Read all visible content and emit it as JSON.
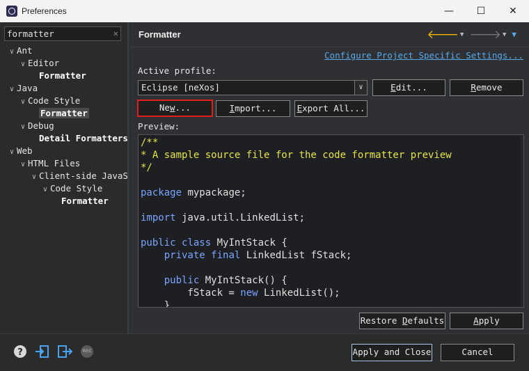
{
  "window": {
    "title": "Preferences",
    "controls": {
      "minimize": "—",
      "maximize": "☐",
      "close": "✕"
    }
  },
  "filter": {
    "value": "formatter",
    "clear_glyph": "✕"
  },
  "tree": [
    {
      "label": "Ant",
      "twisty": "∨",
      "level": 0
    },
    {
      "label": "Editor",
      "twisty": "∨",
      "level": 1
    },
    {
      "label": "Formatter",
      "twisty": "",
      "level": 2,
      "bold": true
    },
    {
      "label": "Java",
      "twisty": "∨",
      "level": 0
    },
    {
      "label": "Code Style",
      "twisty": "∨",
      "level": 1
    },
    {
      "label": "Formatter",
      "twisty": "",
      "level": 2,
      "bold": true,
      "selected": true
    },
    {
      "label": "Debug",
      "twisty": "∨",
      "level": 1
    },
    {
      "label": "Detail Formatters",
      "twisty": "",
      "level": 2,
      "bold": true
    },
    {
      "label": "Web",
      "twisty": "∨",
      "level": 0
    },
    {
      "label": "HTML Files",
      "twisty": "∨",
      "level": 1
    },
    {
      "label": "Client-side JavaScript",
      "twisty": "∨",
      "level": 2
    },
    {
      "label": "Code Style",
      "twisty": "∨",
      "level": 3
    },
    {
      "label": "Formatter",
      "twisty": "",
      "level": 4,
      "bold": true
    }
  ],
  "page": {
    "title": "Formatter",
    "configure_link": "Configure Project Specific Settings...",
    "active_profile_label": "Active profile:",
    "profile_value": "Eclipse [neXos]",
    "buttons": {
      "edit": {
        "pre": "",
        "u": "E",
        "post": "dit..."
      },
      "remove": {
        "pre": "",
        "u": "R",
        "post": "emove"
      },
      "new": {
        "pre": "Ne",
        "u": "w",
        "post": "..."
      },
      "import": {
        "pre": "",
        "u": "I",
        "post": "mport..."
      },
      "export": {
        "pre": "",
        "u": "E",
        "post": "xport All..."
      },
      "restore": {
        "pre": "Restore ",
        "u": "D",
        "post": "efaults"
      },
      "apply": {
        "pre": "",
        "u": "A",
        "post": "pply"
      }
    },
    "preview_label": "Preview:",
    "preview_lines": [
      [
        {
          "t": "/**",
          "c": "cmt"
        }
      ],
      [
        {
          "t": "* A sample source file for the code formatter preview",
          "c": "cmt"
        }
      ],
      [
        {
          "t": "*/",
          "c": "cmt"
        }
      ],
      [],
      [
        {
          "t": "package",
          "c": "kw"
        },
        {
          "t": " mypackage;",
          "c": "txt"
        }
      ],
      [],
      [
        {
          "t": "import",
          "c": "kw"
        },
        {
          "t": " java.util.LinkedList;",
          "c": "txt"
        }
      ],
      [],
      [
        {
          "t": "public",
          "c": "kw"
        },
        {
          "t": " ",
          "c": "txt"
        },
        {
          "t": "class",
          "c": "kw"
        },
        {
          "t": " MyIntStack {",
          "c": "txt"
        }
      ],
      [
        {
          "t": "    ",
          "c": "txt"
        },
        {
          "t": "private",
          "c": "kw"
        },
        {
          "t": " ",
          "c": "txt"
        },
        {
          "t": "final",
          "c": "kw"
        },
        {
          "t": " LinkedList fStack;",
          "c": "txt"
        }
      ],
      [],
      [
        {
          "t": "    ",
          "c": "txt"
        },
        {
          "t": "public",
          "c": "kw"
        },
        {
          "t": " MyIntStack() {",
          "c": "txt"
        }
      ],
      [
        {
          "t": "        fStack = ",
          "c": "txt"
        },
        {
          "t": "new",
          "c": "kw"
        },
        {
          "t": " LinkedList();",
          "c": "txt"
        }
      ],
      [
        {
          "t": "    }",
          "c": "txt"
        }
      ]
    ]
  },
  "footer": {
    "apply_close": "Apply and Close",
    "cancel": "Cancel",
    "icons": [
      "help-icon",
      "import-prefs-icon",
      "export-prefs-icon",
      "record-icon"
    ],
    "record_text": "REC"
  },
  "colors": {
    "accent": "#59a9e8",
    "highlight": "#e0201c",
    "back_arrow": "#f5b700"
  }
}
